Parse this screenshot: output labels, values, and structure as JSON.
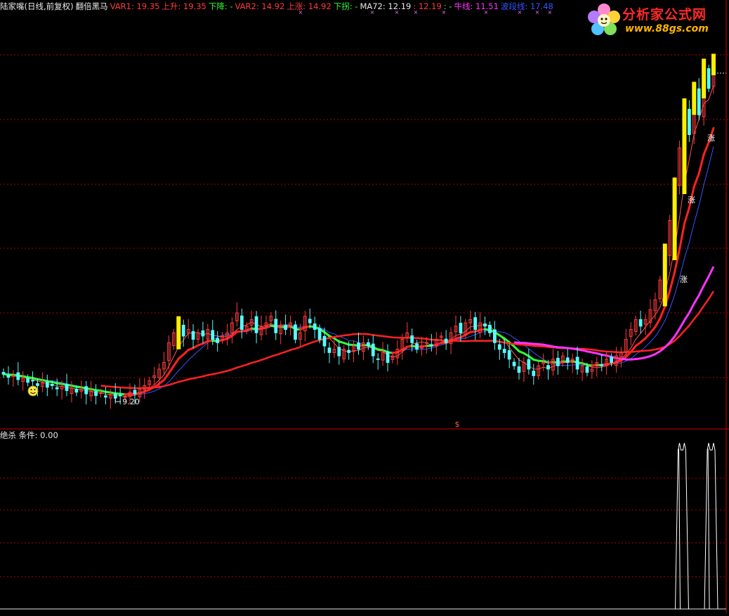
{
  "header": {
    "items": [
      {
        "text": "陆家嘴(日线,前复权)",
        "color": "#e8e8e8"
      },
      {
        "text": "翻倍黑马",
        "color": "#e8e8e8"
      },
      {
        "text": "VAR1: 19.35",
        "color": "#ff3b3b"
      },
      {
        "text": "上升: 19.35",
        "color": "#ff3b3b"
      },
      {
        "text": "下降: -",
        "color": "#33ff33"
      },
      {
        "text": "VAR2: 14.92",
        "color": "#ff3b3b"
      },
      {
        "text": "上涨: 14.92",
        "color": "#ff3b3b"
      },
      {
        "text": "下拐: -",
        "color": "#33ff33"
      },
      {
        "text": "MA72: 12.19",
        "color": "#e8e8e8"
      },
      {
        "text": ": 12.19",
        "color": "#ff3b3b"
      },
      {
        "text": ": -",
        "color": "#33ff33"
      },
      {
        "text": "牛线: 11.51",
        "color": "#ff33ff"
      },
      {
        "text": "波段线: 17.48",
        "color": "#3355ff"
      }
    ]
  },
  "lower_panel": {
    "title": "绝杀",
    "indicator": "条件: 0.00"
  },
  "logo": {
    "name": "分析家公式网",
    "url": "www.88gs.com"
  },
  "annotations": {
    "low_price": "9.20",
    "up_signal": "涨",
    "dollar_marker": "$"
  },
  "colors": {
    "up_candle": "#ff3b3b",
    "down_candle": "#55ffff",
    "signal_bar": "#ffee00",
    "ma_fast": "#ff2222",
    "trend_green": "#33ff33",
    "bull_line": "#ff33ff",
    "wave_line": "#3355ff",
    "grid": "#aa0000"
  },
  "chart_data": [
    {
      "type": "candlestick",
      "title": "",
      "series": [
        {
          "name": "MA72",
          "last": 12.19
        },
        {
          "name": "牛线",
          "last": 11.51
        },
        {
          "name": "波段线",
          "last": 17.48
        },
        {
          "name": "VAR1",
          "last": 19.35
        },
        {
          "name": "VAR2",
          "last": 14.92
        }
      ],
      "ylim": [
        8.5,
        20.0
      ],
      "low_marker": 9.2,
      "grid": true,
      "close": [
        9.95,
        9.85,
        9.9,
        9.78,
        9.82,
        9.7,
        9.75,
        9.6,
        9.68,
        9.55,
        9.6,
        9.5,
        9.58,
        9.45,
        9.52,
        9.4,
        9.48,
        9.35,
        9.42,
        9.3,
        9.38,
        9.25,
        9.32,
        9.22,
        9.3,
        9.26,
        9.4,
        9.35,
        9.5,
        9.6,
        9.75,
        9.9,
        10.1,
        10.3,
        10.9,
        11.2,
        11.4,
        11.1,
        11.3,
        11.0,
        11.2,
        11.1,
        11.3,
        11.0,
        10.9,
        11.1,
        11.2,
        11.5,
        11.8,
        11.3,
        11.4,
        11.6,
        11.2,
        11.4,
        11.5,
        11.7,
        11.2,
        11.4,
        11.3,
        11.5,
        11.0,
        11.2,
        11.7,
        11.5,
        11.3,
        11.0,
        10.8,
        10.6,
        10.7,
        10.5,
        10.7,
        10.6,
        10.8,
        10.7,
        10.9,
        10.8,
        10.5,
        10.4,
        10.6,
        10.3,
        10.5,
        10.7,
        11.0,
        11.2,
        10.9,
        10.7,
        10.8,
        10.9,
        10.8,
        11.0,
        11.1,
        10.9,
        11.2,
        11.4,
        11.2,
        11.5,
        11.6,
        11.3,
        11.5,
        11.4,
        11.2,
        10.9,
        10.7,
        10.6,
        10.4,
        10.2,
        10.0,
        10.3,
        10.1,
        9.9,
        10.2,
        10.3,
        10.1,
        10.4,
        10.2,
        10.5,
        10.3,
        10.4,
        10.1,
        10.2,
        10.0,
        10.1,
        10.3,
        10.2,
        10.4,
        10.3,
        10.5,
        10.6,
        11.0,
        11.3,
        11.6,
        11.4,
        11.6,
        11.9,
        12.2,
        12.8,
        13.6,
        14.6,
        15.6,
        16.8,
        18.0,
        17.2,
        18.5,
        17.8,
        19.2,
        18.6,
        19.35
      ],
      "signal_bars": [
        36,
        136,
        138,
        140,
        142,
        144,
        146,
        148,
        150
      ],
      "condition": {
        "name": "条件",
        "last": 0.0,
        "spikes": [
          139,
          140,
          145,
          146
        ]
      }
    }
  ]
}
